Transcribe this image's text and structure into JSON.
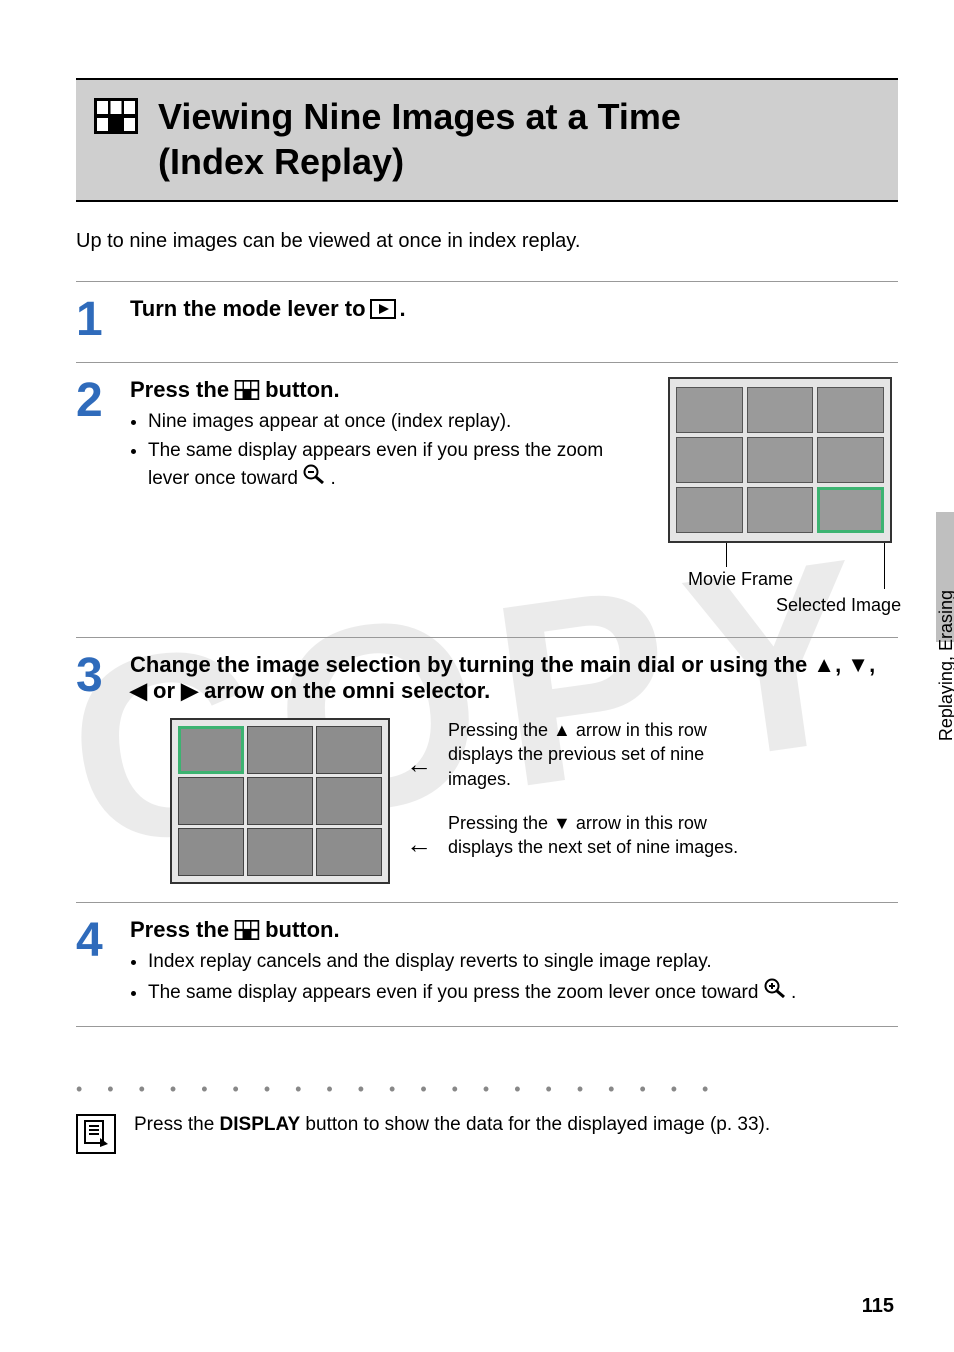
{
  "title_line1": "Viewing Nine Images at a Time",
  "title_line2": "(Index Replay)",
  "intro": "Up to nine images can be viewed at once in index replay.",
  "side_tab": "Replaying, Erasing",
  "page_number": "115",
  "steps": {
    "s1": {
      "num": "1",
      "head_pre": "Turn the mode lever to ",
      "head_post": "."
    },
    "s2": {
      "num": "2",
      "head_pre": "Press the ",
      "head_post": " button.",
      "bullet1": "Nine images appear at once (index replay).",
      "bullet2_pre": "The same display appears even if you press the zoom lever once toward ",
      "bullet2_post": ".",
      "caption_movie": "Movie Frame",
      "caption_selected": "Selected Image"
    },
    "s3": {
      "num": "3",
      "head": "Change the image selection by turning the main dial or using the ▲, ▼, ◀ or ▶ arrow on the omni selector.",
      "note_up": "Pressing the ▲ arrow in this row displays the previous set of nine images.",
      "note_down": "Pressing the ▼ arrow in this row displays the next set of nine images."
    },
    "s4": {
      "num": "4",
      "head_pre": "Press the ",
      "head_post": " button.",
      "bullet1": "Index replay cancels and the display reverts to single image replay.",
      "bullet2_pre": "The same display appears even if you press the zoom lever once toward ",
      "bullet2_post": "."
    }
  },
  "footer_note": {
    "pre": "Press the ",
    "bold": "DISPLAY",
    "post": " button to show the data for the displayed image (p. 33)."
  }
}
